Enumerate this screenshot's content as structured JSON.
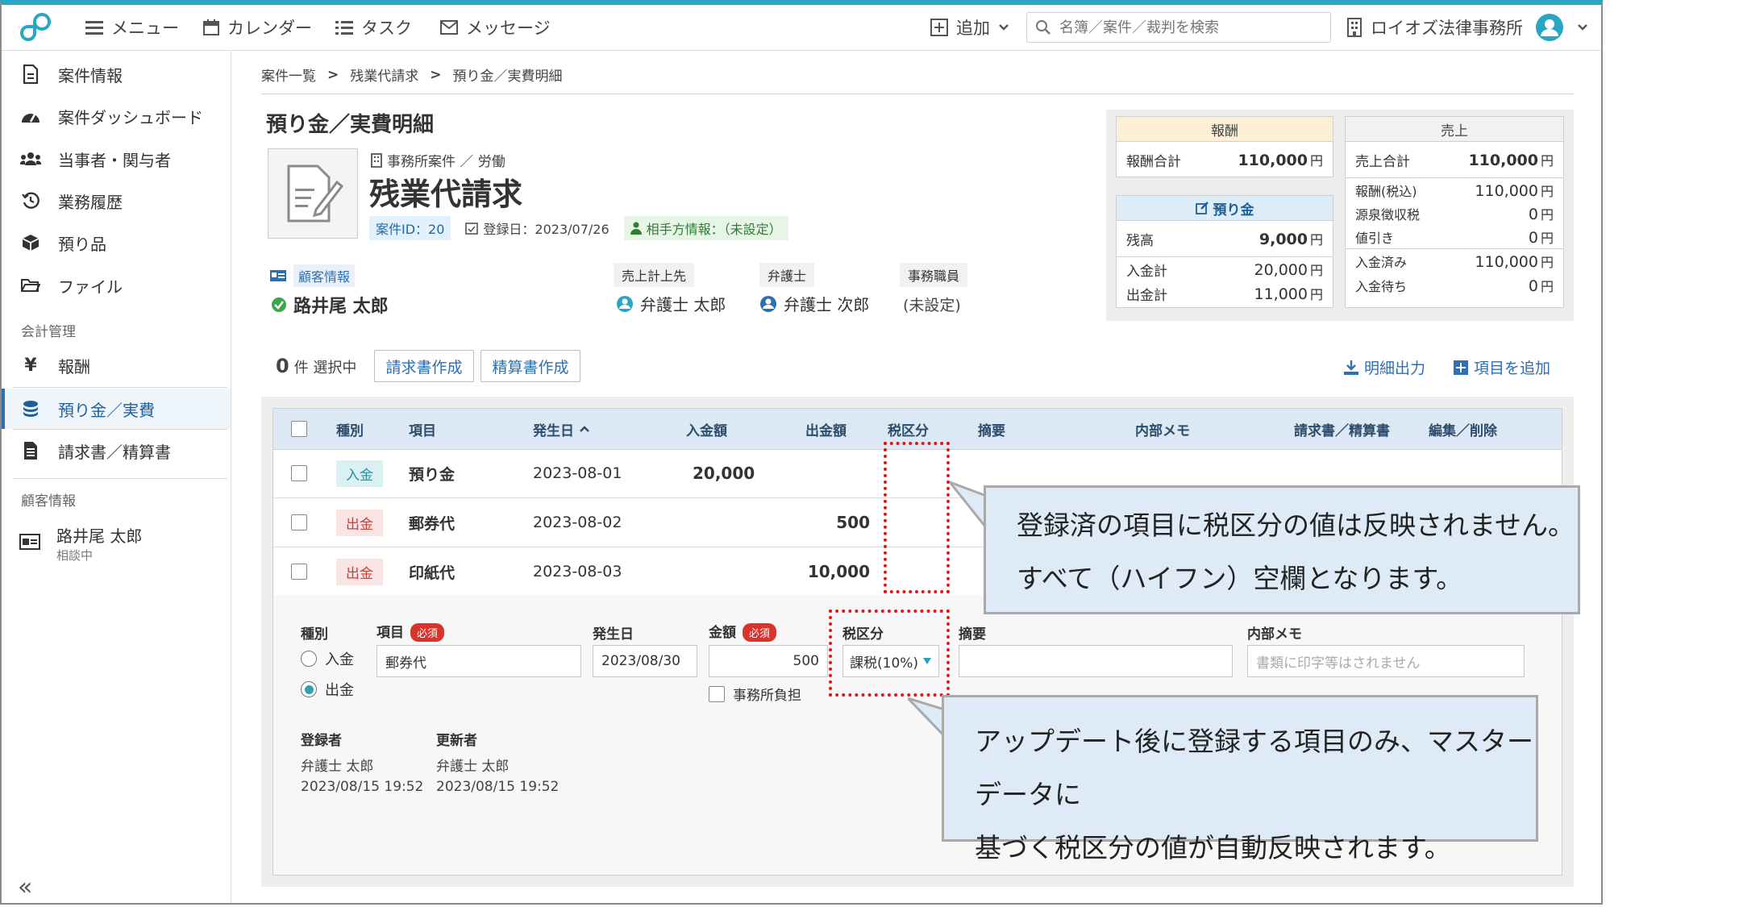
{
  "topbar": {
    "menu": "メニュー",
    "calendar": "カレンダー",
    "task": "タスク",
    "message": "メッセージ",
    "add": "追加",
    "search_placeholder": "名簿／案件／裁判を検索",
    "office": "ロイオズ法律事務所"
  },
  "sidebar": {
    "items": [
      {
        "label": "案件情報",
        "icon": "document-icon"
      },
      {
        "label": "案件ダッシュボード",
        "icon": "gauge-icon"
      },
      {
        "label": "当事者・関与者",
        "icon": "users-icon"
      },
      {
        "label": "業務履歴",
        "icon": "history-icon"
      },
      {
        "label": "預り品",
        "icon": "box-icon"
      },
      {
        "label": "ファイル",
        "icon": "folder-icon"
      }
    ],
    "section_accounting": "会計管理",
    "accounting_items": [
      {
        "label": "報酬",
        "icon": "yen-icon"
      },
      {
        "label": "預り金／実費",
        "icon": "coins-icon",
        "active": true
      },
      {
        "label": "請求書／精算書",
        "icon": "invoice-icon"
      }
    ],
    "section_client": "顧客情報",
    "client_name": "路井尾 太郎",
    "client_status": "相談中",
    "collapse": "«"
  },
  "breadcrumb": [
    "案件一覧",
    "残業代請求",
    "預り金／実費明細"
  ],
  "page_title": "預り金／実費明細",
  "case": {
    "category": "事務所案件 ／ 労働",
    "name": "残業代請求",
    "id_badge": "案件ID：20",
    "registered": "登録日：2023/07/26",
    "opponent": "相手方情報：（未設定）",
    "client_label": "顧客情報",
    "client_name": "路井尾 太郎",
    "sales_label": "売上計上先",
    "sales_value": "弁護士 太郎",
    "lawyer_label": "弁護士",
    "lawyer_value": "弁護士 次郎",
    "staff_label": "事務職員",
    "staff_value": "(未設定)"
  },
  "summary": {
    "fee_head": "報酬",
    "fee_total_label": "報酬合計",
    "fee_total": "110,000",
    "deposit_head": "預り金",
    "balance_label": "残高",
    "balance": "9,000",
    "in_total_label": "入金計",
    "in_total": "20,000",
    "out_total_label": "出金計",
    "out_total": "11,000",
    "sales_head": "売上",
    "sales_total_label": "売上合計",
    "sales_total": "110,000",
    "fee_tax_label": "報酬(税込)",
    "fee_tax": "110,000",
    "withholding_label": "源泉徴収税",
    "withholding": "0",
    "discount_label": "値引き",
    "discount": "0",
    "paid_label": "入金済み",
    "paid": "110,000",
    "pending_label": "入金待ち",
    "pending": "0",
    "unit": "円"
  },
  "toolbar": {
    "selected_count": "0",
    "selected_suffix": "件 選択中",
    "invoice_button": "請求書作成",
    "settlement_button": "精算書作成",
    "export": "明細出力",
    "add_item": "項目を追加"
  },
  "table": {
    "headers": [
      "種別",
      "項目",
      "発生日",
      "入金額",
      "出金額",
      "税区分",
      "摘要",
      "内部メモ",
      "請求書／精算書",
      "編集／削除"
    ],
    "rows": [
      {
        "type": "入金",
        "item": "預り金",
        "date": "2023-08-01",
        "in": "20,000",
        "out": ""
      },
      {
        "type": "出金",
        "item": "郵券代",
        "date": "2023-08-02",
        "in": "",
        "out": "500"
      },
      {
        "type": "出金",
        "item": "印紙代",
        "date": "2023-08-03",
        "in": "",
        "out": "10,000"
      }
    ]
  },
  "form": {
    "type_label": "種別",
    "radio_in": "入金",
    "radio_out": "出金",
    "item_label": "項目",
    "required": "必須",
    "item_value": "郵券代",
    "date_label": "発生日",
    "date_value": "2023/08/30",
    "amount_label": "金額",
    "amount_value": "500",
    "office_burden": "事務所負担",
    "tax_label": "税区分",
    "tax_value": "課税(10%)",
    "summary_label": "摘要",
    "memo_label": "内部メモ",
    "memo_placeholder": "書類に印字等はされません",
    "registrant_label": "登録者",
    "registrant": "弁護士 太郎",
    "registered_at": "2023/08/15 19:52",
    "updater_label": "更新者",
    "updater": "弁護士 太郎",
    "updated_at": "2023/08/15 19:52"
  },
  "annotations": {
    "callout1_line1": "登録済の項目に税区分の値は反映されません。",
    "callout1_line2": "すべて（ハイフン）空欄となります。",
    "callout2_line1": "アップデート後に登録する項目のみ、マスターデータに",
    "callout2_line2": "基づく税区分の値が自動反映されます。"
  },
  "colors": {
    "accent": "#2f6fb0",
    "brand": "#27a7c4",
    "annotation": "#e0161b"
  }
}
